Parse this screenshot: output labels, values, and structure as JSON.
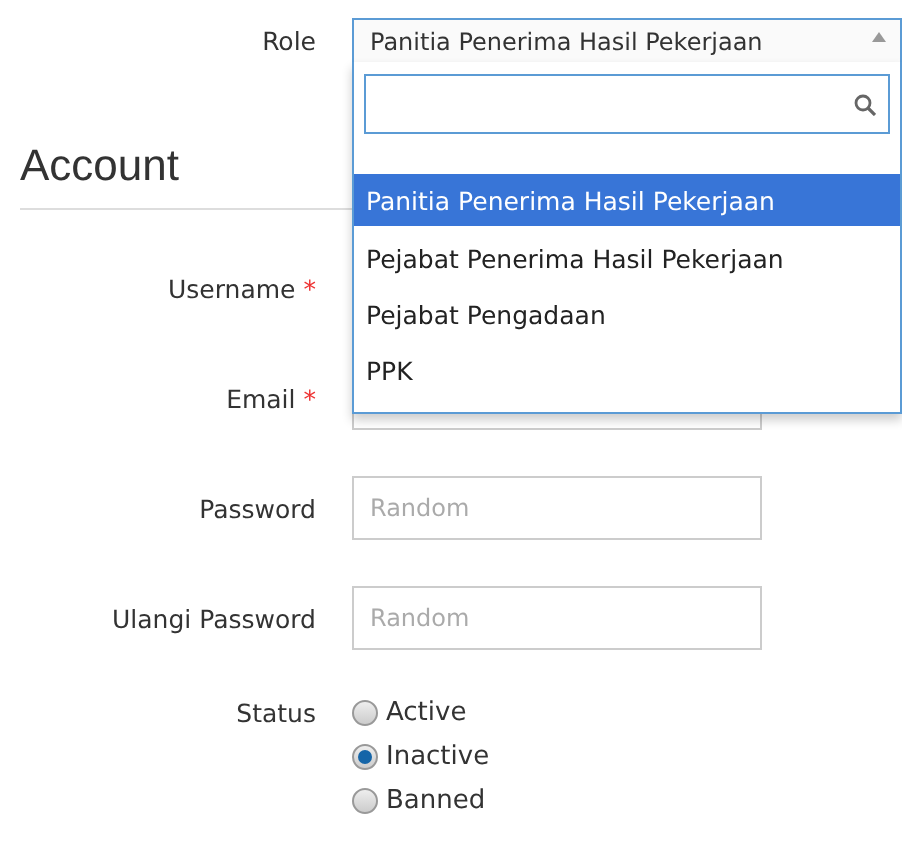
{
  "role": {
    "label": "Role",
    "value": "Panitia Penerima Hasil Pekerjaan",
    "expanded": true,
    "options": [
      {
        "label": "Panitia Penerima Hasil Pekerjaan",
        "selected": true
      },
      {
        "label": "Pejabat Penerima Hasil Pekerjaan",
        "selected": false
      },
      {
        "label": "Pejabat Pengadaan",
        "selected": false
      },
      {
        "label": "PPK",
        "selected": false
      }
    ]
  },
  "section_title": "Account",
  "rows": [
    {
      "kind": "label",
      "label": "Username",
      "marker": "*"
    },
    {
      "kind": "text",
      "label": "Email",
      "marker": "*"
    },
    {
      "kind": "text",
      "label": "Password",
      "placeholder": "Random"
    },
    {
      "kind": "text",
      "label": "Ulangi Password",
      "placeholder": "Random"
    },
    {
      "kind": "radios",
      "label": "Status",
      "options": [
        {
          "label": "Active",
          "selected": false
        },
        {
          "label": "Inactive",
          "selected": true
        },
        {
          "label": "Banned",
          "selected": false
        }
      ]
    }
  ]
}
